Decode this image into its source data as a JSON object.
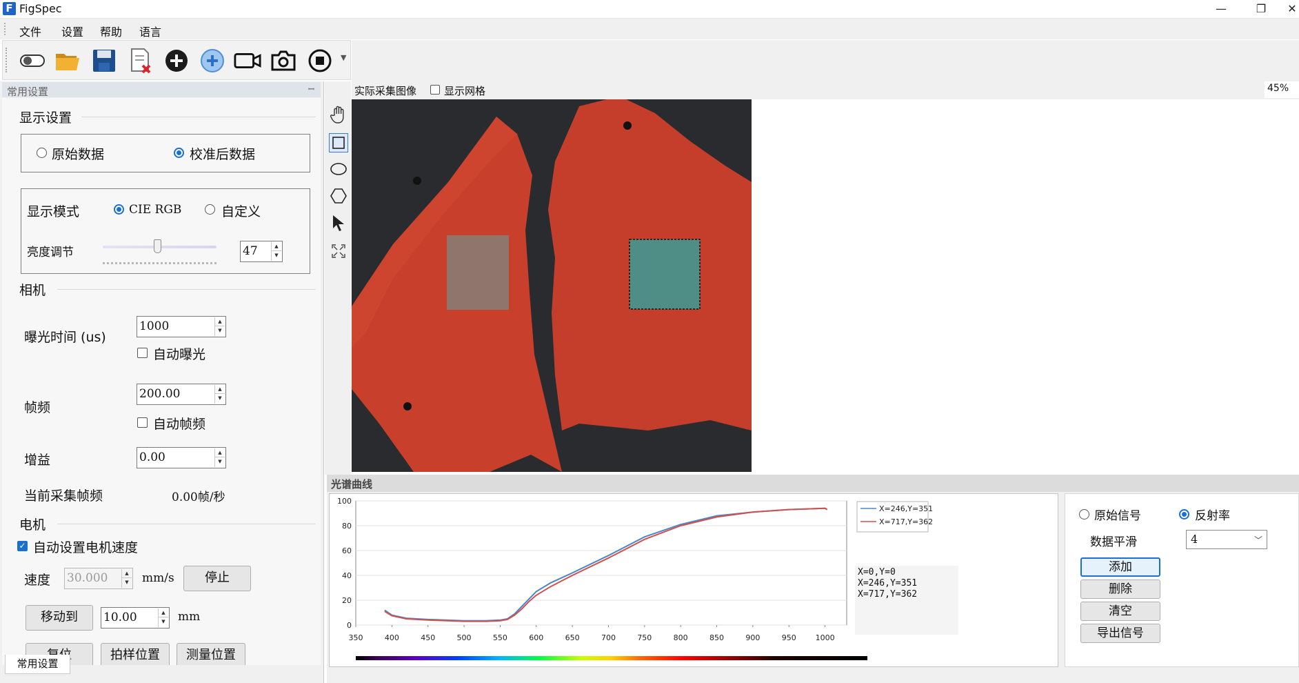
{
  "window": {
    "app_icon": "F",
    "title": "FigSpec",
    "minimize_glyph": "—",
    "restore_glyph": "❐",
    "close_glyph": "✕"
  },
  "menu": [
    "文件",
    "设置",
    "帮助",
    "语言"
  ],
  "toolbar": {
    "icons": [
      "toggle-switch-icon",
      "open-folder-icon",
      "save-disk-icon",
      "clear-document-icon",
      "add-circle-icon",
      "add-blue-circle-icon",
      "video-camera-icon",
      "photo-camera-icon",
      "stop-circle-icon"
    ],
    "more_glyph": "▼"
  },
  "left_panel": {
    "title": "常用设置",
    "pin_glyph": "ꟷ",
    "display": {
      "header": "显示设置",
      "raw_label": "原始数据",
      "calibrated_label": "校准后数据",
      "selected": "calibrated",
      "mode_label": "显示模式",
      "cie_rgb_label": "CIE RGB",
      "custom_label": "自定义",
      "mode_selected": "cie_rgb",
      "brightness_label": "亮度调节",
      "brightness_value": "47",
      "brightness_level": 0.47
    },
    "camera": {
      "header": "相机",
      "exposure_label": "曝光时间 (us)",
      "exposure_value": "1000",
      "auto_exposure_label": "自动曝光",
      "auto_exposure": false,
      "framerate_label": "帧频",
      "framerate_value": "200.00",
      "auto_framerate_label": "自动帧频",
      "auto_framerate": false,
      "gain_label": "增益",
      "gain_value": "0.00",
      "current_rate_label": "当前采集帧频",
      "current_rate_value": "0.00帧/秒"
    },
    "motor": {
      "header": "电机",
      "auto_speed_label": "自动设置电机速度",
      "auto_speed": true,
      "speed_label": "速度",
      "speed_value": "30.000",
      "speed_unit": "mm/s",
      "stop_button": "停止",
      "move_to_button": "移动到",
      "move_to_value": "10.00",
      "move_unit": "mm",
      "reset_button": "复位",
      "scan_pos_button": "拍样位置",
      "measure_pos_button": "测量位置"
    },
    "bottom_tab": "常用设置"
  },
  "image_view": {
    "caption": "实际采集图像",
    "show_grid_label": "显示网格",
    "show_grid": false,
    "zoom": "45%",
    "tools": [
      "hand-pan-icon",
      "rectangle-select-icon",
      "ellipse-select-icon",
      "polygon-select-icon",
      "pointer-arrow-icon",
      "fit-view-icon"
    ]
  },
  "spectrum": {
    "title": "光谱曲线",
    "raw_signal_label": "原始信号",
    "reflectance_label": "反射率",
    "selected": "reflectance",
    "smooth_label": "数据平滑",
    "smooth_value": "4",
    "add_button": "添加",
    "delete_button": "删除",
    "clear_button": "清空",
    "export_button": "导出信号",
    "coords": [
      "X=0,Y=0",
      "X=246,Y=351",
      "X=717,Y=362"
    ]
  },
  "chart_data": {
    "type": "line",
    "title": "",
    "xlabel": "",
    "ylabel": "",
    "xlim": [
      350,
      1030
    ],
    "ylim": [
      0,
      100
    ],
    "x_ticks": [
      350,
      400,
      450,
      500,
      550,
      600,
      650,
      700,
      750,
      800,
      850,
      900,
      950,
      1000
    ],
    "y_ticks": [
      0,
      20,
      40,
      60,
      80,
      100
    ],
    "grid": true,
    "legend": "top-right",
    "x": [
      390,
      400,
      420,
      450,
      500,
      530,
      550,
      560,
      570,
      580,
      590,
      600,
      620,
      650,
      700,
      750,
      800,
      850,
      900,
      950,
      1000,
      1003
    ],
    "series": [
      {
        "name": "X=246,Y=351",
        "color": "#4a86c8",
        "values": [
          12,
          8,
          5.5,
          4.5,
          3.5,
          3.5,
          4,
          5,
          9,
          15,
          21,
          27,
          34,
          42,
          56,
          71,
          81,
          88,
          91,
          93,
          94,
          93
        ]
      },
      {
        "name": "X=717,Y=362",
        "color": "#d05050",
        "values": [
          11,
          7.5,
          5,
          4,
          3,
          3,
          3.5,
          4.5,
          8,
          13,
          19,
          24,
          31,
          40,
          54,
          69,
          80,
          87,
          91,
          93,
          94,
          93
        ]
      }
    ]
  }
}
